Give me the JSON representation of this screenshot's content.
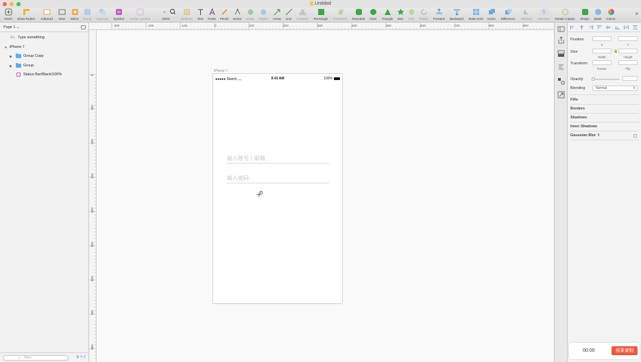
{
  "window": {
    "title": "Untitled"
  },
  "toolbar": {
    "items": [
      {
        "label": "Insert"
      },
      {
        "label": "Show Rulers"
      },
      {
        "label": "Artboard"
      },
      {
        "label": "View"
      },
      {
        "label": "Mirror"
      },
      {
        "label": "Group"
      },
      {
        "label": "Ungroup"
      },
      {
        "label": "Symbol"
      },
      {
        "label": "Create Symbol"
      },
      {
        "label": "100%"
      },
      {
        "label": "Outlines"
      },
      {
        "label": "Text"
      },
      {
        "label": "Fonts"
      },
      {
        "label": "Pencil"
      },
      {
        "label": "Vector"
      },
      {
        "label": "Scale"
      },
      {
        "label": "Flatten"
      },
      {
        "label": "Arrow"
      },
      {
        "label": "Line"
      },
      {
        "label": "Scissors"
      },
      {
        "label": "Transform"
      },
      {
        "label": "Rectangle"
      },
      {
        "label": "Rounded"
      },
      {
        "label": "Oval"
      },
      {
        "label": "Triangle"
      },
      {
        "label": "Star"
      },
      {
        "label": "Edit"
      },
      {
        "label": "Rotate"
      },
      {
        "label": "Forward"
      },
      {
        "label": "Backward"
      },
      {
        "label": "Make Grid"
      },
      {
        "label": "Union"
      },
      {
        "label": "Difference"
      },
      {
        "label": "Subtract"
      },
      {
        "label": "Intersect"
      },
      {
        "label": "Rotate Copies"
      },
      {
        "label": "Shape"
      },
      {
        "label": "Mask"
      },
      {
        "label": "Colors"
      }
    ]
  },
  "pages": {
    "current": "Page 1"
  },
  "layers": {
    "top_text": "Type something",
    "artboard": "iPhone 7",
    "items": [
      {
        "label": "Group Copy"
      },
      {
        "label": "Group"
      },
      {
        "label": "Status Bar/Black/100%"
      }
    ],
    "filter_placeholder": "Filter",
    "filter_count": "6"
  },
  "rulers": {
    "top": [
      "-300",
      "-200",
      "-100",
      "0",
      "100",
      "200",
      "300",
      "400",
      "500",
      "600",
      "700",
      "800",
      "900"
    ],
    "left": [
      "0",
      "100",
      "200",
      "300",
      "400",
      "500",
      "600",
      "700",
      "800"
    ]
  },
  "artboard": {
    "name": "iPhone 7",
    "status": {
      "carrier": "●●●●● Sketch",
      "time": "9:41 AM",
      "battery": "100%"
    },
    "fields": {
      "account_placeholder": "输入账号 / 邮箱",
      "password_placeholder": "输入密码"
    }
  },
  "inspector": {
    "position": "Position",
    "x": "X",
    "y": "Y",
    "size": "Size",
    "width": "Width",
    "height": "Height",
    "transform": "Transform",
    "rotate": "Rotate",
    "flip": "Flip",
    "opacity": "Opacity",
    "blending": "Blending",
    "blending_value": "Normal",
    "fills": "Fills",
    "borders": "Borders",
    "shadows": "Shadows",
    "inner_shadows": "Inner Shadows",
    "gaussian_blur": "Gaussian Blur"
  },
  "recorder": {
    "time": "00:00",
    "stop_label": "结束录制"
  },
  "colors": {
    "accent": "#f0583c",
    "folder": "#5aaef0",
    "symbol": "#c05ec8"
  }
}
